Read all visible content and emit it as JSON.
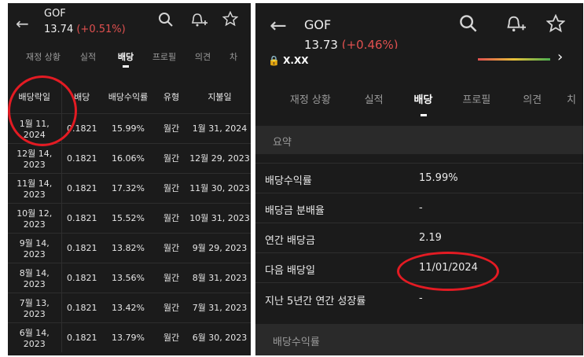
{
  "left": {
    "ticker": "GOF",
    "price": "13.74",
    "change": "(+0.51%)",
    "tabs": [
      "재정 상황",
      "실적",
      "배당",
      "프로필",
      "의견",
      "차"
    ],
    "active_tab": 2,
    "columns": [
      "배당락일",
      "배당",
      "배당수익률",
      "유형",
      "지불일"
    ],
    "rows": [
      [
        "1월 11, 2024",
        "0.1821",
        "15.99%",
        "월간",
        "1월 31, 2024"
      ],
      [
        "12월 14, 2023",
        "0.1821",
        "16.06%",
        "월간",
        "12월 29, 2023"
      ],
      [
        "11월 14, 2023",
        "0.1821",
        "17.32%",
        "월간",
        "11월 30, 2023"
      ],
      [
        "10월 12, 2023",
        "0.1821",
        "15.52%",
        "월간",
        "10월 31, 2023"
      ],
      [
        "9월 14, 2023",
        "0.1821",
        "13.82%",
        "월간",
        "9월 29, 2023"
      ],
      [
        "8월 14, 2023",
        "0.1821",
        "13.56%",
        "월간",
        "8월 31, 2023"
      ],
      [
        "7월 13, 2023",
        "0.1821",
        "13.42%",
        "월간",
        "7월 31, 2023"
      ],
      [
        "6월 14, 2023",
        "0.1821",
        "13.79%",
        "월간",
        "6월 30, 2023"
      ]
    ]
  },
  "right": {
    "ticker": "GOF",
    "price": "13.73",
    "change": "(+0.46%)",
    "locked_value": "X.XX",
    "tabs": [
      "재정 상황",
      "실적",
      "배당",
      "프로필",
      "의견",
      "치"
    ],
    "active_tab": 2,
    "summary_title": "요약",
    "summary": [
      {
        "label": "배당수익률",
        "value": "15.99%"
      },
      {
        "label": "배당금 분배율",
        "value": "-"
      },
      {
        "label": "연간 배당금",
        "value": "2.19"
      },
      {
        "label": "다음 배당일",
        "value": "11/01/2024"
      },
      {
        "label": "지난 5년간 연간 성장률",
        "value": "-"
      }
    ],
    "next_section": "배당수익률"
  },
  "icons": [
    "back-arrow-icon",
    "search-icon",
    "add-alert-bell-icon",
    "star-icon",
    "lock-icon",
    "chevron-right-icon"
  ],
  "colors": {
    "background": "#1b1b1b",
    "negative": "#e0504f",
    "annotation": "#e31b23"
  }
}
